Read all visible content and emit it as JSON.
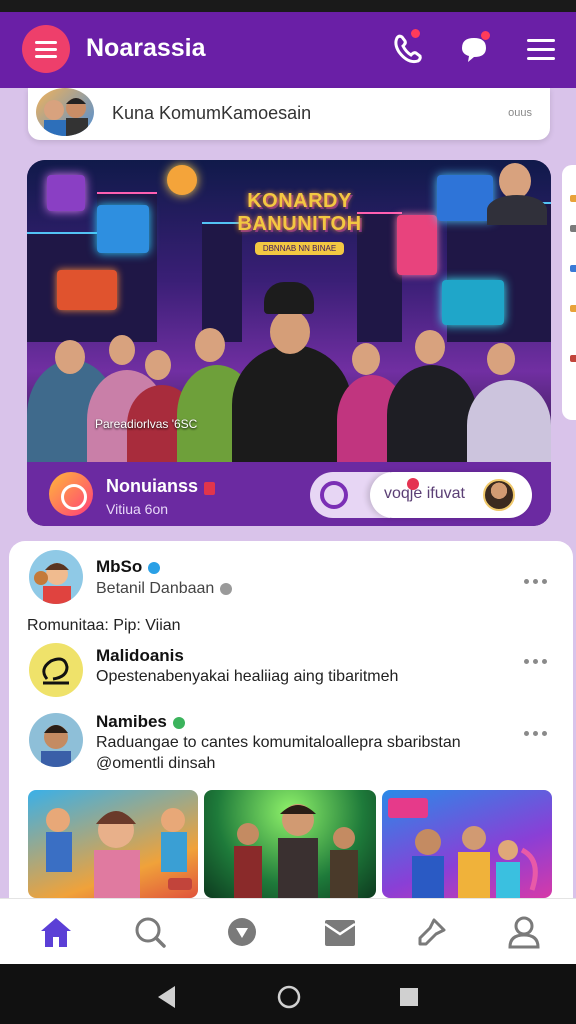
{
  "app": {
    "title": "Noarassia"
  },
  "colors": {
    "primary": "#6a1fa6",
    "accent": "#ee3f6b",
    "nav_active": "#5b3fd6"
  },
  "header": {
    "menu_icon": "menu-icon",
    "icons": [
      "phone-icon",
      "chat-bubble-icon",
      "hamburger-icon"
    ]
  },
  "community": {
    "label": "Kuna KomumKamoesain",
    "side_text": "ouus"
  },
  "feature": {
    "banner_title_1": "KONARDY",
    "banner_title_2": "BANUNITOH",
    "banner_sub": "DBNNAB NN BINAE",
    "caption": "Pareadiorlvas '6SC",
    "footer_title": "Nonuianss",
    "footer_sub": "Vitiua 6on",
    "pill_text": "voqje ifuvat"
  },
  "feed": {
    "posts": [
      {
        "name": "MbSo",
        "text": "Betanil Danbaan"
      },
      {
        "name": "Malidoanis",
        "text": "Opestenabenyakai healiiag aing tibaritmeh"
      },
      {
        "name": "Namibes",
        "text": "Raduangae to cantes komumitaloallepra sbaribstan",
        "text2": "@omentli dinsah"
      }
    ],
    "section_label": "Romunitaa: Pip: Viian"
  },
  "bottom_nav": [
    "home-icon",
    "search-icon",
    "explore-icon",
    "mail-icon",
    "pin-icon",
    "profile-icon"
  ]
}
